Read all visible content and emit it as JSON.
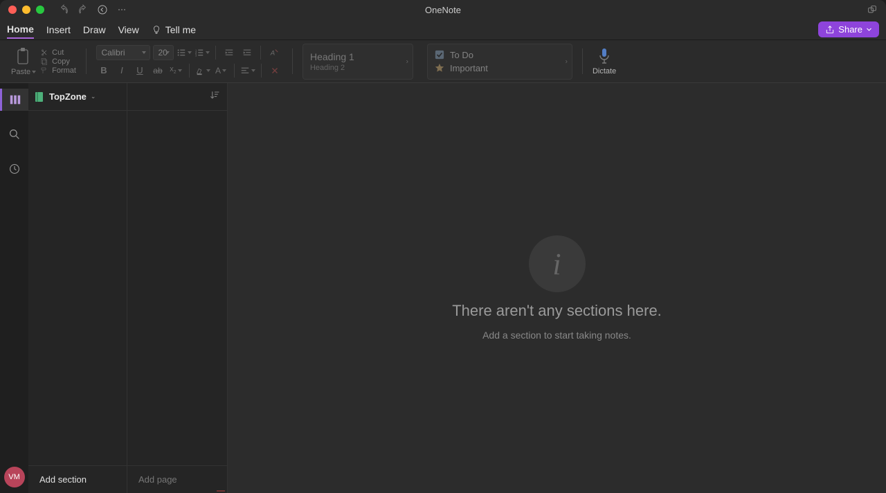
{
  "titlebar": {
    "title": "OneNote"
  },
  "menu": {
    "tabs": [
      "Home",
      "Insert",
      "Draw",
      "View"
    ],
    "tell_me": "Tell me",
    "share": "Share"
  },
  "ribbon": {
    "paste": "Paste",
    "cut": "Cut",
    "copy": "Copy",
    "format": "Format",
    "font_name": "Calibri",
    "font_size": "20",
    "styles": {
      "h1": "Heading 1",
      "h2": "Heading 2"
    },
    "tags": {
      "todo": "To Do",
      "important": "Important"
    },
    "dictate": "Dictate"
  },
  "sidebar": {
    "notebook": "TopZone",
    "avatar": "VM",
    "add_section": "Add section",
    "add_page": "Add page"
  },
  "empty": {
    "title": "There aren't any sections here.",
    "subtitle": "Add a section to start taking notes."
  }
}
